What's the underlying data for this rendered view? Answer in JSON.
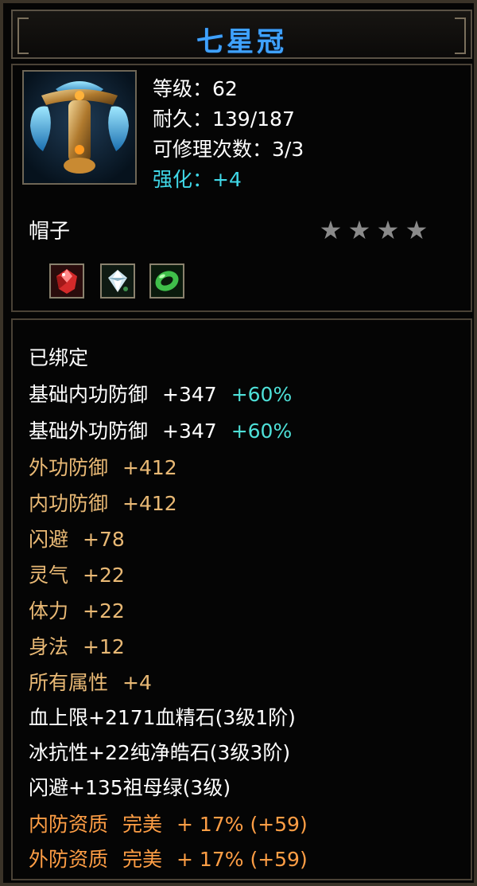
{
  "title": "七星冠",
  "stats": {
    "level": "等级：62",
    "durability": "耐久：139/187",
    "repairs": "可修理次数：3/3",
    "enhance": "强化：+4"
  },
  "item_type": "帽子",
  "stars": [
    "★",
    "★",
    "★",
    "★"
  ],
  "gems": [
    "ruby-gem-icon",
    "diamond-gem-icon",
    "jade-gem-icon"
  ],
  "attributes": {
    "bound": "已绑定",
    "base_inner_def": {
      "label": "基础内功防御",
      "value": "+347",
      "pct": "+60%"
    },
    "base_outer_def": {
      "label": "基础外功防御",
      "value": "+347",
      "pct": "+60%"
    },
    "outer_def": {
      "label": "外功防御",
      "value": "+412"
    },
    "inner_def": {
      "label": "内功防御",
      "value": "+412"
    },
    "dodge": {
      "label": "闪避",
      "value": "+78"
    },
    "spirit": {
      "label": "灵气",
      "value": "+22"
    },
    "stamina": {
      "label": "体力",
      "value": "+22"
    },
    "agility": {
      "label": "身法",
      "value": "+12"
    },
    "all_attr": {
      "label": "所有属性",
      "value": "+4"
    },
    "gem_line_1": "血上限+2171血精石(3级1阶)",
    "gem_line_2": "冰抗性+22纯净皓石(3级3阶)",
    "gem_line_3": "闪避+135祖母绿(3级)",
    "quality_inner": {
      "label": "内防资质",
      "grade": "完美",
      "value": "+ 17% (+59)"
    },
    "quality_outer": {
      "label": "外防资质",
      "grade": "完美",
      "value": "+ 17% (+59)"
    }
  },
  "colors": {
    "title": "#3fa2ff",
    "enhance": "#40d8e8",
    "stat_gold": "#e9b975",
    "quality_orange": "#ff9e45",
    "percent_cyan": "#4ee0d8"
  }
}
